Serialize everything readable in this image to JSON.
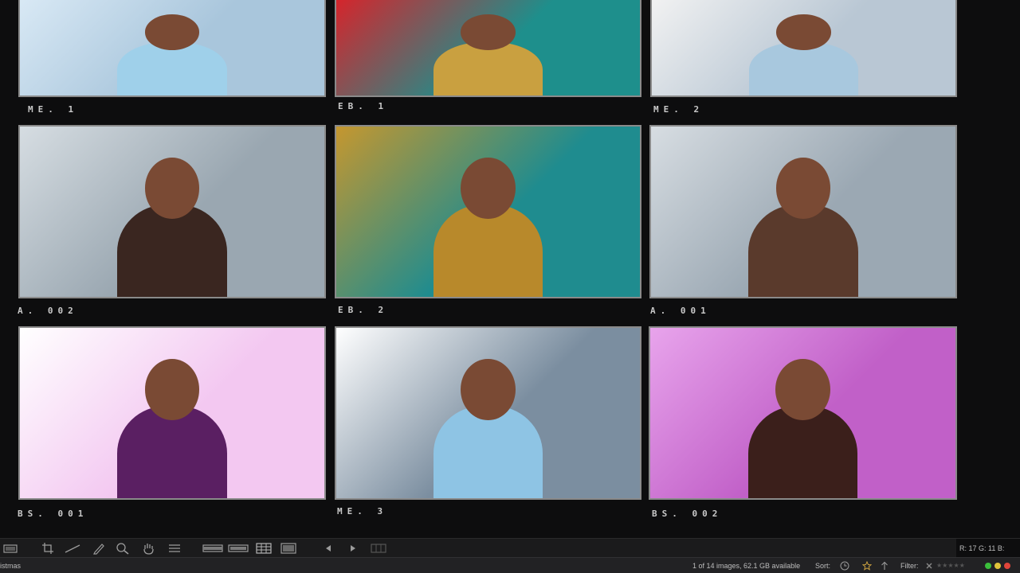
{
  "window": {
    "title_fragment": "istmas"
  },
  "grid": {
    "tiles": [
      {
        "caption": "ME. 1",
        "bg": "#a9c6dc",
        "accent": "#d9e9f5",
        "figure": "#9fd0ea"
      },
      {
        "caption": "EB. 1",
        "bg": "#1e8f8c",
        "accent": "#d8232a",
        "figure": "#c9a040"
      },
      {
        "caption": "ME. 2",
        "bg": "#b9c7d4",
        "accent": "#f2f2f2",
        "figure": "#a8c8de"
      },
      {
        "caption": "A. 002",
        "bg": "#9aa7b1",
        "accent": "#d6dde2",
        "figure": "#3a2620"
      },
      {
        "caption": "EB. 2",
        "bg": "#1f8c8f",
        "accent": "#c5972f",
        "figure": "#b8892b"
      },
      {
        "caption": "A. 001",
        "bg": "#9ba8b3",
        "accent": "#d7dde2",
        "figure": "#5a3a2c"
      },
      {
        "caption": "BS. 001",
        "bg": "#f3c8f1",
        "accent": "#ffffff",
        "figure": "#5a1f62"
      },
      {
        "caption": "ME. 3",
        "bg": "#7b8ea0",
        "accent": "#ffffff",
        "figure": "#8ec4e4"
      },
      {
        "caption": "BS. 002",
        "bg": "#c160c8",
        "accent": "#e8a4ec",
        "figure": "#3b1f1b"
      }
    ]
  },
  "toolbar": {
    "tools": [
      "viewer-toggle-icon",
      "crop-icon",
      "straighten-icon",
      "pencil-icon",
      "zoom-icon",
      "hand-icon",
      "list-icon",
      "filmstrip-icon",
      "filmstrip-alt-icon",
      "grid-icon",
      "single-view-icon",
      "prev-icon",
      "next-icon",
      "compare-icon"
    ],
    "rgb_readout": "R:   17  G:   11  B:"
  },
  "status": {
    "image_count": "1 of 14 images, 62.1 GB available",
    "sort_label": "Sort:",
    "filter_label": "Filter:"
  },
  "colors": {
    "accent_green": "#3bbf3b",
    "accent_yellow": "#e0c23a",
    "accent_red": "#e0453a"
  }
}
